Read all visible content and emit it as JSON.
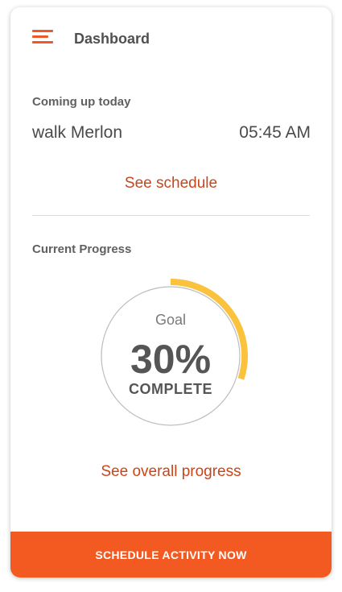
{
  "header": {
    "title": "Dashboard",
    "menu_icon": "hamburger-menu-icon"
  },
  "upcoming": {
    "label": "Coming up today",
    "activity": "walk Merlon",
    "time": "05:45 AM",
    "link_label": "See schedule"
  },
  "progress": {
    "label": "Current Progress",
    "goal_label": "Goal",
    "percent_text": "30%",
    "complete_label": "COMPLETE",
    "fraction": 0.3,
    "arc_color": "#fbc23d",
    "ring_color": "#bdbdbd",
    "link_label": "See overall progress"
  },
  "cta": {
    "label": "SCHEDULE ACTIVITY NOW",
    "color": "#f25a22"
  },
  "colors": {
    "accent": "#f0582a",
    "link": "#c9451a"
  }
}
